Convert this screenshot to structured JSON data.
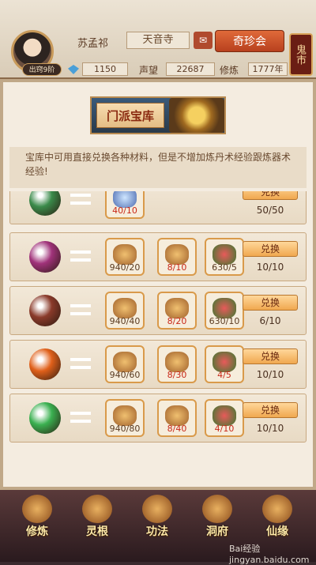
{
  "player": {
    "name": "苏孟祁",
    "rank": "出窍9阶",
    "sect": "天音寺",
    "gems": "1150",
    "fame_label": "声望",
    "fame": "22687",
    "cultivation_label": "修炼",
    "cultivation": "1777年"
  },
  "header": {
    "treasure_button": "奇珍会",
    "market_button": "鬼市"
  },
  "banner": {
    "title": "门派宝库"
  },
  "description": "宝库中可用直接兑换各种材料，但是不增加炼丹术经验跟炼器术经验!",
  "exchange_label": "兑换",
  "rows": [
    {
      "orb_color": "#3a8a4a",
      "costs": [
        "40/10"
      ],
      "cost_colors": [
        "#c82818"
      ],
      "ratio": "50/50"
    },
    {
      "orb_color": "#a0327a",
      "costs": [
        "940/20",
        "8/10",
        "630/5"
      ],
      "cost_colors": [
        "#5a3a20",
        "#c82818",
        "#5a3a20"
      ],
      "ratio": "10/10"
    },
    {
      "orb_color": "#8a3a2a",
      "costs": [
        "940/40",
        "8/20",
        "630/10"
      ],
      "cost_colors": [
        "#5a3a20",
        "#c82818",
        "#5a3a20"
      ],
      "ratio": "6/10"
    },
    {
      "orb_color": "#e0601a",
      "costs": [
        "940/60",
        "8/30",
        "4/5"
      ],
      "cost_colors": [
        "#5a3a20",
        "#c82818",
        "#c82818"
      ],
      "ratio": "10/10"
    },
    {
      "orb_color": "#3ab050",
      "costs": [
        "940/80",
        "8/40",
        "4/10"
      ],
      "cost_colors": [
        "#5a3a20",
        "#c82818",
        "#c82818"
      ],
      "ratio": "10/10"
    }
  ],
  "nav": [
    {
      "label": "修炼"
    },
    {
      "label": "灵根"
    },
    {
      "label": "功法"
    },
    {
      "label": "洞府"
    },
    {
      "label": "仙缘"
    }
  ],
  "watermark": "Bai经验 jingyan.baidu.com"
}
